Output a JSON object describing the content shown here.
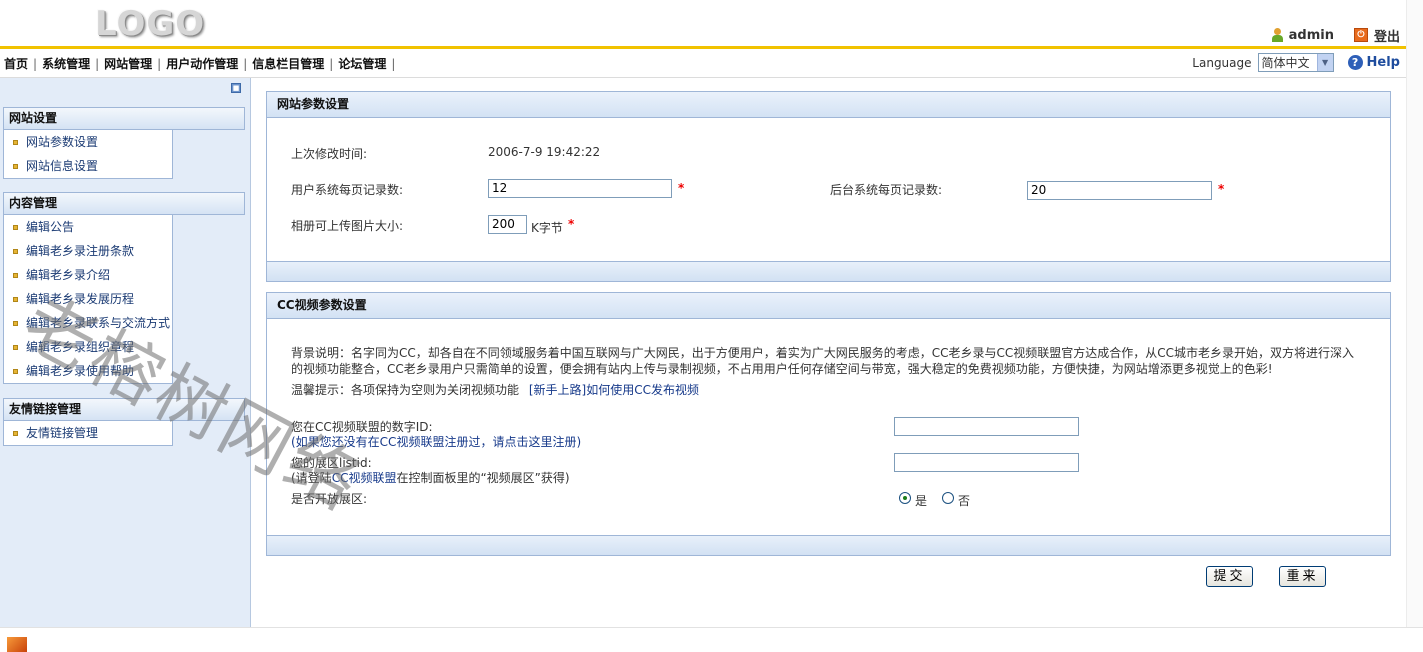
{
  "header": {
    "logo_text": "LOGO",
    "username": "admin",
    "logout_label": "登出"
  },
  "nav": {
    "items": [
      "首页",
      "系统管理",
      "网站管理",
      "用户动作管理",
      "信息栏目管理",
      "论坛管理"
    ],
    "language_label": "Language",
    "language_selected": "简体中文",
    "help_label": "Help"
  },
  "sidebar": {
    "groups": [
      {
        "title": "网站设置",
        "items": [
          "网站参数设置",
          "网站信息设置"
        ]
      },
      {
        "title": "内容管理",
        "items": [
          "编辑公告",
          "编辑老乡录注册条款",
          "编辑老乡录介绍",
          "编辑老乡录发展历程",
          "编辑老乡录联系与交流方式",
          "编辑老乡录组织章程",
          "编辑老乡录使用帮助"
        ]
      },
      {
        "title": "友情链接管理",
        "items": [
          "友情链接管理"
        ]
      }
    ]
  },
  "site_params": {
    "title": "网站参数设置",
    "last_modified_label": "上次修改时间:",
    "last_modified_value": "2006-7-9 19:42:22",
    "user_page_label": "用户系统每页记录数:",
    "user_page_value": "12",
    "admin_page_label": "后台系统每页记录数:",
    "admin_page_value": "20",
    "album_size_label": "相册可上传图片大小:",
    "album_size_value": "200",
    "album_size_unit": "K字节",
    "required_mark": "*"
  },
  "cc_params": {
    "title": "CC视频参数设置",
    "background_line1": "背景说明：名字同为CC，却各自在不同领域服务着中国互联网与广大网民，出于方便用户，着实为广大网民服务的考虑，CC老乡录与CC视频联盟官方达成合作，从CC城市老乡录开始，双方将进行深入",
    "background_line2": "的视频功能整合，CC老乡录用户只需简单的设置，便会拥有站内上传与录制视频，不占用用户任何存储空间与带宽，强大稳定的免费视频功能，方便快捷，为网站增添更多视觉上的色彩!",
    "tip_prefix": "温馨提示：各项保持为空则为关闭视频功能",
    "tip_link": "[新手上路]如何使用CC发布视频",
    "cc_id_label": "您在CC视频联盟的数字ID:",
    "cc_id_hint": "(如果您还没有在CC视频联盟注册过，请点击这里注册)",
    "cc_id_value": "",
    "listid_label": "您的展区listid:",
    "listid_hint_prefix": "(请登陆",
    "listid_hint_link": "CC视频联盟",
    "listid_hint_suffix": "在控制面板里的“视频展区”获得)",
    "listid_value": "",
    "open_label": "是否开放展区:",
    "open_yes": "是",
    "open_no": "否",
    "open_selected": "是"
  },
  "actions": {
    "submit_label": "提交",
    "reset_label": "重来"
  },
  "watermark": "老榕树网络"
}
